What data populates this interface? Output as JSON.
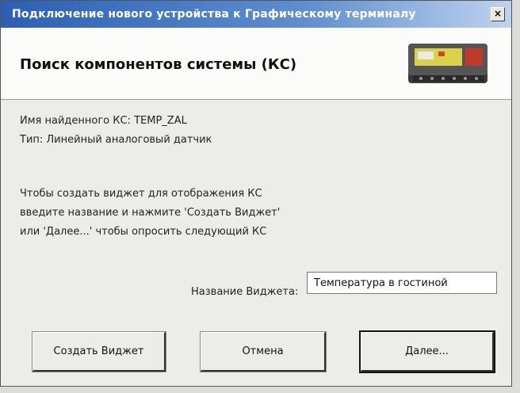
{
  "window": {
    "title": "Подключение нового устройства к Графическому терминалу",
    "close_label": "×"
  },
  "header": {
    "title": "Поиск компонентов системы (КС)"
  },
  "found": {
    "name_line": "Имя найденного КС: TEMP_ZAL",
    "type_line": "Тип: Линейный аналоговый датчик"
  },
  "instructions": [
    "Чтобы создать виджет для отображения КС",
    "введите название и нажмите 'Создать Виджет'",
    "или 'Далее...' чтобы опросить следующий КС"
  ],
  "widget_name": {
    "label": "Название Виджета:",
    "value": "Температура в гостиной"
  },
  "buttons": {
    "create": "Создать Виджет",
    "cancel": "Отмена",
    "next": "Далее..."
  },
  "colors": {
    "title_bar_start": "#2a5fb4",
    "title_bar_end": "#bfd3ee",
    "dialog_bg": "#ecece9"
  }
}
